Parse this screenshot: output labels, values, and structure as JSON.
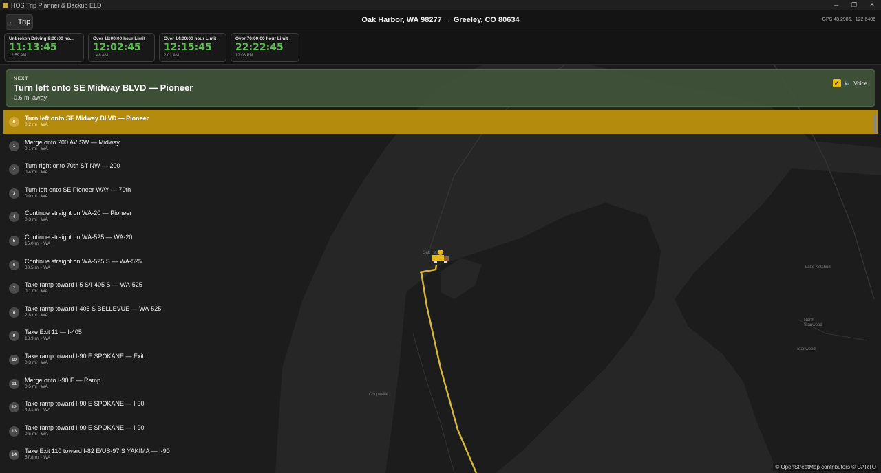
{
  "window": {
    "title": "HOS Trip Planner & Backup ELD",
    "minimize": "─",
    "maximize": "❐",
    "close": "✕"
  },
  "header": {
    "back_icon": "←",
    "back_label": "Trip",
    "route": "Oak Harbor, WA 98277 → Greeley, CO 80634",
    "gps": "GPS 48.2986, -122.6406"
  },
  "hos_cards": [
    {
      "label": "Unbroken Driving 8:00:00 ho...",
      "value": "11:13:45",
      "time": "12:59 AM"
    },
    {
      "label": "Over 11:00:00 hour Limit",
      "value": "12:02:45",
      "time": "1:48 AM"
    },
    {
      "label": "Over 14:00:00 hour Limit",
      "value": "12:15:45",
      "time": "2:01 AM"
    },
    {
      "label": "Over 70:00:00 hour Limit",
      "value": "22:22:45",
      "time": "12:08 PM"
    }
  ],
  "next": {
    "label": "NEXT",
    "instruction": "Turn left onto SE Midway BLVD — Pioneer",
    "distance": "0.6 mi away",
    "voice_label": "Voice",
    "voice_icon": "🔈",
    "voice_checked": true,
    "check_mark": "✓"
  },
  "steps": [
    {
      "num": "0",
      "text": "Turn left onto SE Midway BLVD — Pioneer",
      "meta": "0.2 mi · WA",
      "active": true
    },
    {
      "num": "1",
      "text": "Merge onto 200 AV SW — Midway",
      "meta": "0.1 mi · WA"
    },
    {
      "num": "2",
      "text": "Turn right onto 70th ST NW — 200",
      "meta": "0.4 mi · WA"
    },
    {
      "num": "3",
      "text": "Turn left onto SE Pioneer WAY — 70th",
      "meta": "0.0 mi · WA"
    },
    {
      "num": "4",
      "text": "Continue straight on WA-20 — Pioneer",
      "meta": "0.3 mi · WA"
    },
    {
      "num": "5",
      "text": "Continue straight on WA-525 — WA-20",
      "meta": "15.0 mi · WA"
    },
    {
      "num": "6",
      "text": "Continue straight on WA-525 S — WA-525",
      "meta": "30.5 mi · WA"
    },
    {
      "num": "7",
      "text": "Take ramp toward I-5 S/I-405 S — WA-525",
      "meta": "0.1 mi · WA"
    },
    {
      "num": "8",
      "text": "Take ramp toward I-405 S BELLEVUE — WA-525",
      "meta": "2.8 mi · WA"
    },
    {
      "num": "9",
      "text": "Take Exit 11 — I-405",
      "meta": "18.9 mi · WA"
    },
    {
      "num": "10",
      "text": "Take ramp toward I-90 E SPOKANE — Exit",
      "meta": "0.3 mi · WA"
    },
    {
      "num": "11",
      "text": "Merge onto I-90 E — Ramp",
      "meta": "0.5 mi · WA"
    },
    {
      "num": "12",
      "text": "Take ramp toward I-90 E SPOKANE — I-90",
      "meta": "42.1 mi · WA"
    },
    {
      "num": "13",
      "text": "Take ramp toward I-90 E SPOKANE — I-90",
      "meta": "0.5 mi · WA"
    },
    {
      "num": "14",
      "text": "Take Exit 110 toward I-82 E/US-97 S YAKIMA — I-90",
      "meta": "57.8 mi · WA"
    }
  ],
  "map": {
    "labels": {
      "coupeville": "Coupeville",
      "oak_harbor": "Oak Harbor",
      "lake_ketchum": "Lake Ketchum",
      "north_stanwood": "North Stanwood",
      "stanwood": "Stanwood"
    },
    "attribution": "© OpenStreetMap contributors © CARTO",
    "route_color": "#d4b73a",
    "land_color": "#1c1c1c",
    "water_color": "#2a2a2a"
  }
}
